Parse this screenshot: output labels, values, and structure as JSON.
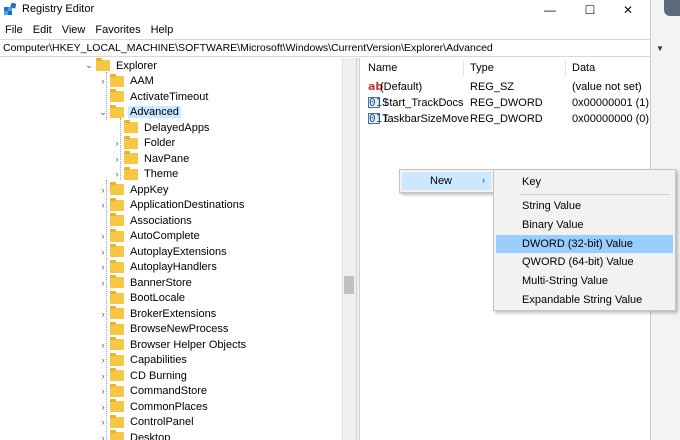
{
  "window": {
    "title": "Registry Editor",
    "controls": {
      "minimize": "—",
      "maximize": "☐",
      "close": "✕"
    }
  },
  "menu": [
    "File",
    "Edit",
    "View",
    "Favorites",
    "Help"
  ],
  "address": "Computer\\HKEY_LOCAL_MACHINE\\SOFTWARE\\Microsoft\\Windows\\CurrentVersion\\Explorer\\Advanced",
  "tree": {
    "root": "Explorer",
    "children": [
      "AAM",
      "ActivateTimeout",
      "Advanced"
    ],
    "advanced_children": [
      "DelayedApps",
      "Folder",
      "NavPane",
      "Theme"
    ],
    "siblings": [
      "AppKey",
      "ApplicationDestinations",
      "Associations",
      "AutoComplete",
      "AutoplayExtensions",
      "AutoplayHandlers",
      "BannerStore",
      "BootLocale",
      "BrokerExtensions",
      "BrowseNewProcess",
      "Browser Helper Objects",
      "Capabilities",
      "CD Burning",
      "CommandStore",
      "CommonPlaces",
      "ControlPanel",
      "Desktop"
    ]
  },
  "values": {
    "headers": {
      "name": "Name",
      "type": "Type",
      "data": "Data"
    },
    "rows": [
      {
        "name": "(Default)",
        "type": "REG_SZ",
        "data": "(value not set)",
        "icon": "string-value-icon"
      },
      {
        "name": "Start_TrackDocs",
        "type": "REG_DWORD",
        "data": "0x00000001 (1)",
        "icon": "binary-value-icon"
      },
      {
        "name": "TaskbarSizeMove",
        "type": "REG_DWORD",
        "data": "0x00000000 (0)",
        "icon": "binary-value-icon"
      }
    ]
  },
  "context_menu": {
    "new_label": "New",
    "arrow": "›",
    "submenu": [
      "Key",
      "String Value",
      "Binary Value",
      "DWORD (32-bit) Value",
      "QWORD (64-bit) Value",
      "Multi-String Value",
      "Expandable String Value"
    ],
    "highlighted": "DWORD (32-bit) Value"
  },
  "colors": {
    "selection": "#cce8ff",
    "menu_highlight": "#99ccff",
    "folder": "#f6c644"
  }
}
